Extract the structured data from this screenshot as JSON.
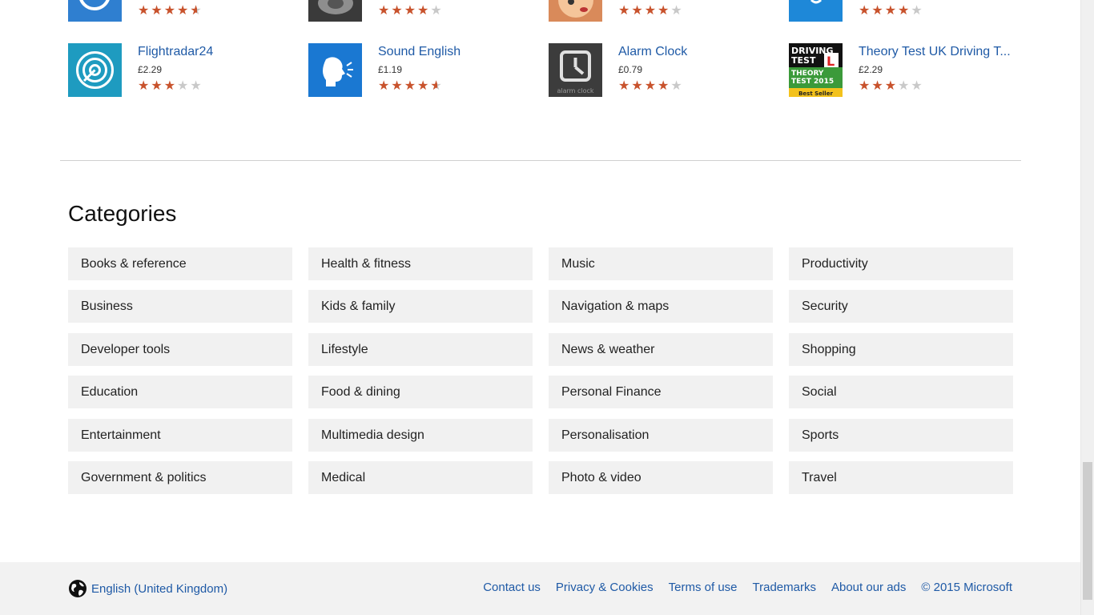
{
  "top_row": [
    {
      "rating": 4.5
    },
    {
      "rating": 4
    },
    {
      "rating": 4
    },
    {
      "rating": 4
    }
  ],
  "apps": [
    {
      "name": "Flightradar24",
      "price": "£2.29",
      "rating": 3,
      "icon": "radar-icon"
    },
    {
      "name": "Sound English",
      "price": "£1.19",
      "rating": 4.5,
      "icon": "speaking-head-icon"
    },
    {
      "name": "Alarm Clock",
      "price": "£0.79",
      "rating": 4,
      "icon": "clock-icon"
    },
    {
      "name": "Theory Test UK Driving T...",
      "price": "£2.29",
      "rating": 3,
      "icon": "driving-test-icon"
    }
  ],
  "driving_icon_text": {
    "line1": "DRIVING",
    "line2": "TEST",
    "line3": "THEORY",
    "line4": "TEST 2015",
    "badge": "Best Seller"
  },
  "alarm_icon_text": "alarm clock",
  "categories_title": "Categories",
  "categories": [
    [
      "Books & reference",
      "Business",
      "Developer tools",
      "Education",
      "Entertainment",
      "Government & politics"
    ],
    [
      "Health & fitness",
      "Kids & family",
      "Lifestyle",
      "Food & dining",
      "Multimedia design",
      "Medical"
    ],
    [
      "Music",
      "Navigation & maps",
      "News & weather",
      "Personal Finance",
      "Personalisation",
      "Photo & video"
    ],
    [
      "Productivity",
      "Security",
      "Shopping",
      "Social",
      "Sports",
      "Travel"
    ]
  ],
  "footer": {
    "locale": "English (United Kingdom)",
    "links": [
      "Contact us",
      "Privacy & Cookies",
      "Terms of use",
      "Trademarks",
      "About our ads"
    ],
    "copyright": "© 2015 Microsoft"
  },
  "colors": {
    "link": "#1f5aa6",
    "star": "#c8522c",
    "tile_bg": "#f1f1f1",
    "footer_bg": "#f2f2f2"
  }
}
